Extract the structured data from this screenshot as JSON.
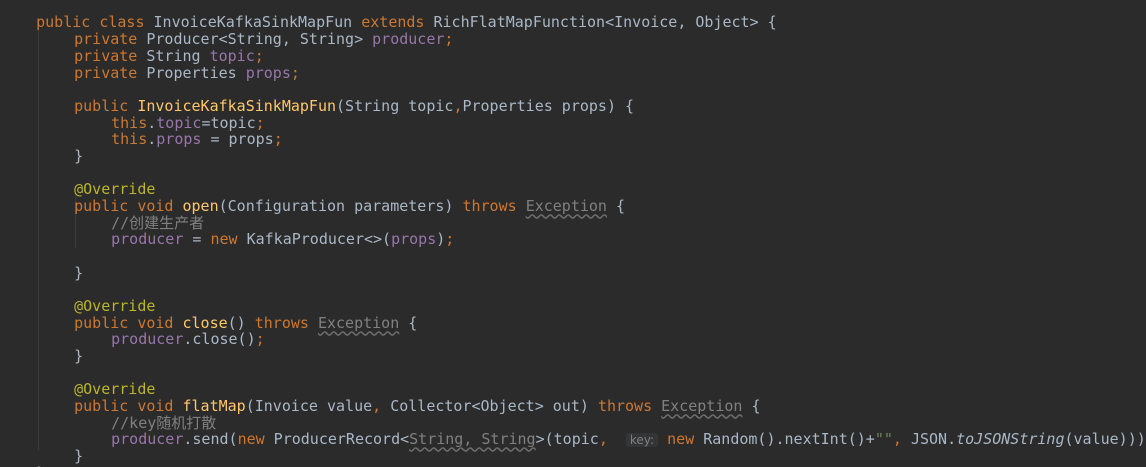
{
  "code_lines": [
    "public class InvoiceKafkaSinkMapFun extends RichFlatMapFunction<Invoice, Object> {",
    "    private Producer<String, String> producer;",
    "    private String topic;",
    "    private Properties props;",
    "",
    "    public InvoiceKafkaSinkMapFun(String topic,Properties props) {",
    "        this.topic=topic;",
    "        this.props = props;",
    "    }",
    "",
    "    @Override",
    "    public void open(Configuration parameters) throws Exception {",
    "        //创建生产者",
    "        producer = new KafkaProducer<>(props);",
    "",
    "    }",
    "",
    "    @Override",
    "    public void close() throws Exception {",
    "        producer.close();",
    "    }",
    "",
    "    @Override",
    "    public void flatMap(Invoice value, Collector<Object> out) throws Exception {",
    "        //key随机打散",
    "        producer.send(new ProducerRecord<String, String>(topic,  key: new Random().nextInt()+\"\", JSON.toJSONString(value)));",
    "    }",
    "}"
  ],
  "tokens": {
    "l0": [
      "public",
      " ",
      "class",
      " ",
      "InvoiceKafkaSinkMapFun",
      " ",
      "extends",
      " ",
      "RichFlatMapFunction<Invoice, Object> {"
    ],
    "l1": [
      "private",
      " Producer<String, String> ",
      "producer",
      ";"
    ],
    "l2": [
      "private",
      " String ",
      "topic",
      ";"
    ],
    "l3": [
      "private",
      " Properties ",
      "props",
      ";"
    ],
    "l5": [
      "public",
      " ",
      "InvoiceKafkaSinkMapFun",
      "(String topic",
      ",",
      "Properties props) {"
    ],
    "l6": [
      "this",
      ".",
      "topic",
      "=topic",
      ";"
    ],
    "l7": [
      "this",
      ".",
      "props",
      " = props",
      ";"
    ],
    "l8": [
      "}"
    ],
    "l10": [
      "@Override"
    ],
    "l11": [
      "public",
      " ",
      "void",
      " ",
      "open",
      "(Configuration parameters) ",
      "throws",
      " ",
      "Exception",
      " {"
    ],
    "l12": [
      "//创建生产者"
    ],
    "l13": [
      "producer",
      " = ",
      "new",
      " KafkaProducer<>(",
      "props",
      ")",
      ";"
    ],
    "l15": [
      "}"
    ],
    "l17": [
      "@Override"
    ],
    "l18": [
      "public",
      " ",
      "void",
      " ",
      "close",
      "() ",
      "throws",
      " ",
      "Exception",
      " {"
    ],
    "l19": [
      "producer",
      ".close()",
      ";"
    ],
    "l20": [
      "}"
    ],
    "l22": [
      "@Override"
    ],
    "l23": [
      "public",
      " ",
      "void",
      " ",
      "flatMap",
      "(Invoice value",
      ",",
      " Collector<Object> out) ",
      "throws",
      " ",
      "Exception",
      " {"
    ],
    "l24": [
      "//key随机打散"
    ],
    "l25": [
      "producer",
      ".send(",
      "new",
      " ProducerRecord<",
      "String",
      ", ",
      "String",
      ">(topic",
      ",",
      "  ",
      "key:",
      " ",
      "new",
      " Random().nextInt()+",
      "\"\"",
      ", ",
      "JSON.",
      "toJSONString",
      "(value))",
      ")",
      ";"
    ],
    "l26": [
      "}"
    ],
    "l27": [
      "}"
    ]
  },
  "colors": {
    "background": "#2b2b2b",
    "default_text": "#a9b7c6",
    "keyword": "#cc7832",
    "field": "#9876aa",
    "method_declaration": "#ffc66d",
    "annotation": "#bbb529",
    "comment": "#808080",
    "string": "#6a8759"
  }
}
